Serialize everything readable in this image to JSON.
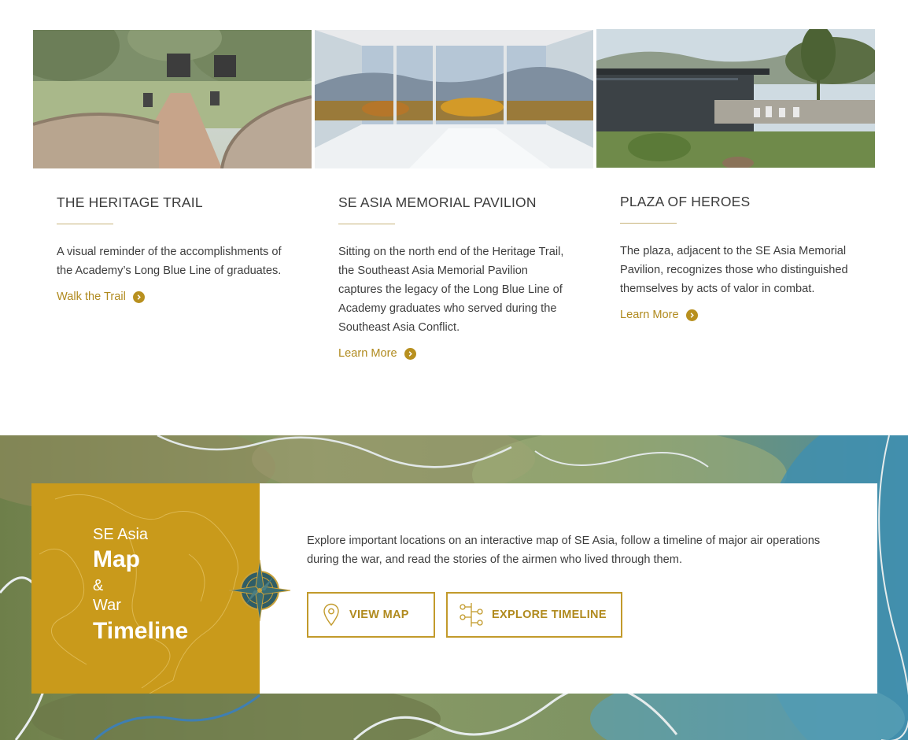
{
  "cards": [
    {
      "title": "THE HERITAGE TRAIL",
      "text": "A visual reminder of the accomplishments of the Academy’s Long Blue Line of graduates.",
      "link": "Walk the Trail",
      "image_icon": "heritage-trail-photo"
    },
    {
      "title": "SE ASIA MEMORIAL PAVILION",
      "text": "Sitting on the north end of the Heritage Trail, the Southeast Asia Memorial Pavilion captures the legacy of the Long Blue Line of Academy graduates who served during the Southeast Asia Conflict.",
      "link": "Learn More",
      "image_icon": "pavilion-interior-photo"
    },
    {
      "title": "PLAZA OF HEROES",
      "text": "The plaza, adjacent to the SE Asia Memorial Pavilion, recognizes those who distinguished themselves by acts of valor in combat.",
      "link": "Learn More",
      "image_icon": "plaza-of-heroes-photo"
    }
  ],
  "map_section": {
    "panel": {
      "line1": "SE Asia",
      "line2": "Map",
      "line3": "&",
      "line4": "War",
      "line5": "Timeline"
    },
    "description": "Explore important locations on an interactive map of SE Asia, follow a timeline of major air operations during the war, and read the stories of the airmen who lived through them.",
    "buttons": {
      "map": "VIEW MAP",
      "timeline": "EXPLORE TIMELINE"
    },
    "icons": {
      "map_button": "map-pin-icon",
      "timeline_button": "timeline-icon",
      "compass": "compass-rose-icon"
    }
  },
  "colors": {
    "gold": "#c99a1b",
    "link_gold": "#b08a1e",
    "text": "#3d3d3d"
  }
}
